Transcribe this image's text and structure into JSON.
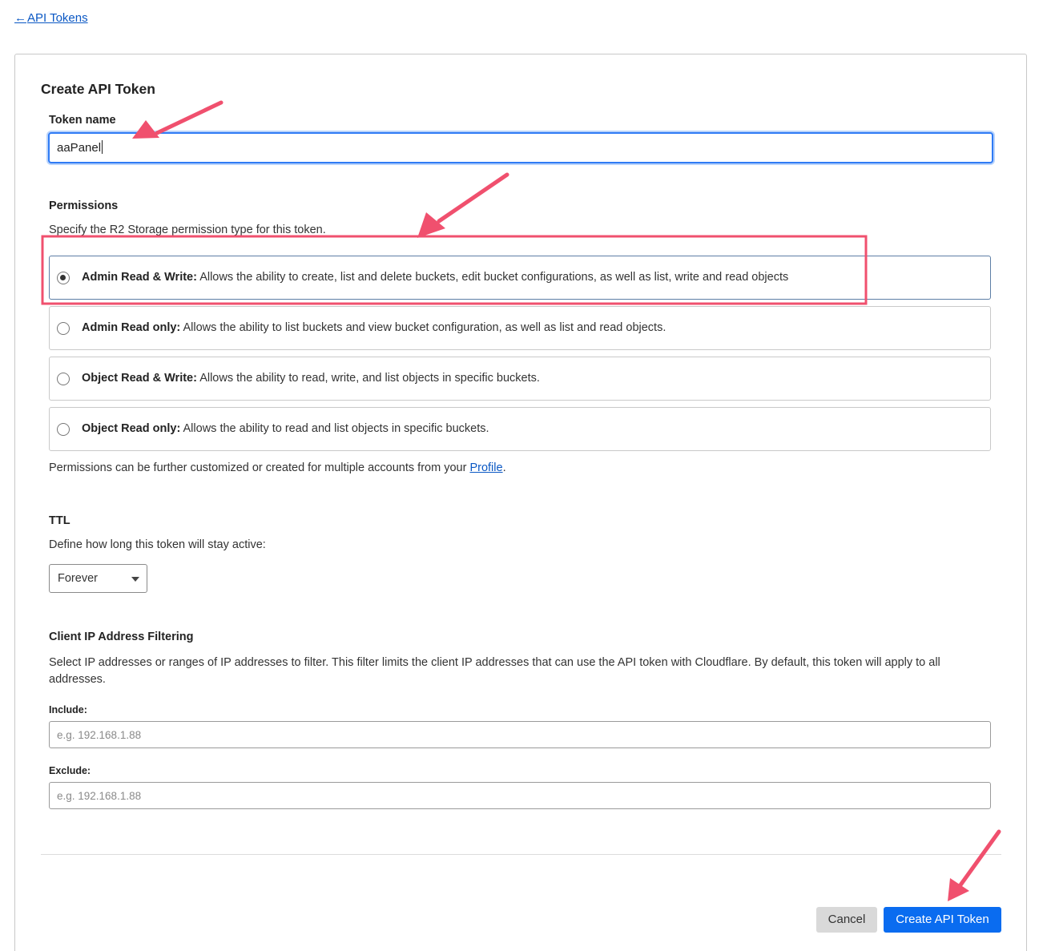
{
  "nav": {
    "back_arrow": "←",
    "back_label": "API Tokens"
  },
  "form": {
    "title": "Create API Token",
    "token_name": {
      "label": "Token name",
      "value": "aaPanel"
    },
    "permissions": {
      "label": "Permissions",
      "description": "Specify the R2 Storage permission type for this token.",
      "options": [
        {
          "name": "Admin Read & Write:",
          "description": "Allows the ability to create, list and delete buckets, edit bucket configurations, as well as list, write and read objects",
          "selected": true
        },
        {
          "name": "Admin Read only:",
          "description": "Allows the ability to list buckets and view bucket configuration, as well as list and read objects.",
          "selected": false
        },
        {
          "name": "Object Read & Write:",
          "description": "Allows the ability to read, write, and list objects in specific buckets.",
          "selected": false
        },
        {
          "name": "Object Read only:",
          "description": "Allows the ability to read and list objects in specific buckets.",
          "selected": false
        }
      ],
      "footer_text": "Permissions can be further customized or created for multiple accounts from your",
      "footer_link": "Profile",
      "footer_end": "."
    },
    "ttl": {
      "label": "TTL",
      "description": "Define how long this token will stay active:",
      "selected": "Forever"
    },
    "ip_filtering": {
      "label": "Client IP Address Filtering",
      "description": "Select IP addresses or ranges of IP addresses to filter. This filter limits the client IP addresses that can use the API token with Cloudflare. By default, this token will apply to all addresses.",
      "include_label": "Include:",
      "include_placeholder": "e.g. 192.168.1.88",
      "exclude_label": "Exclude:",
      "exclude_placeholder": "e.g. 192.168.1.88"
    },
    "actions": {
      "cancel": "Cancel",
      "create": "Create API Token"
    }
  },
  "annotation": {
    "color": "#f0506e"
  }
}
